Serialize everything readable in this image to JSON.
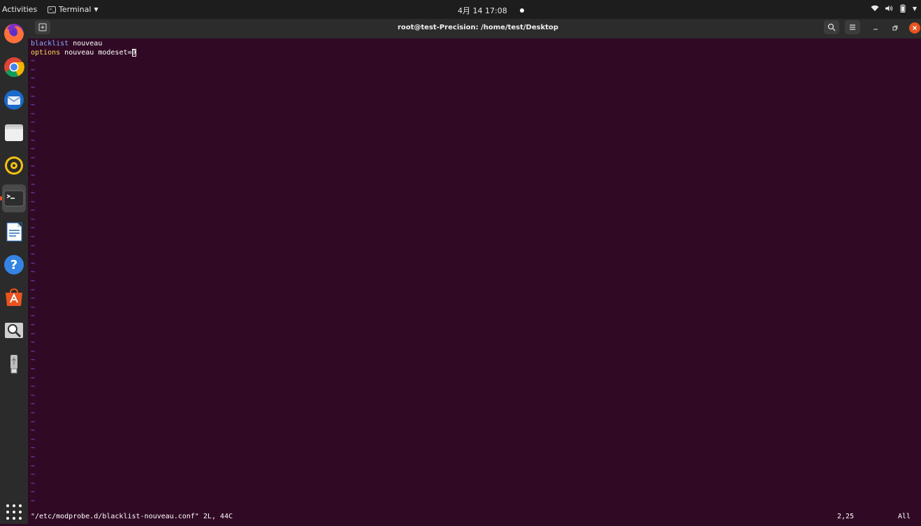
{
  "topbar": {
    "activities": "Activities",
    "app_name": "Terminal",
    "clock": "4月 14  17:08"
  },
  "dock": {
    "items": [
      {
        "name": "firefox-icon"
      },
      {
        "name": "chrome-icon"
      },
      {
        "name": "thunderbird-icon"
      },
      {
        "name": "files-icon"
      },
      {
        "name": "rhythmbox-icon"
      },
      {
        "name": "terminal-icon",
        "active": true
      },
      {
        "name": "writer-icon"
      },
      {
        "name": "help-icon"
      },
      {
        "name": "software-icon"
      },
      {
        "name": "image-viewer-icon"
      },
      {
        "name": "usb-drive-icon"
      },
      {
        "name": "show-apps-icon"
      }
    ]
  },
  "window": {
    "title": "root@test-Precision: /home/test/Desktop"
  },
  "editor": {
    "line1_keyword": "blacklist",
    "line1_rest": " nouveau",
    "line2_keyword": "options",
    "line2_rest": " nouveau modeset=",
    "line2_cursor_char": "0",
    "empty_line_marker": "~",
    "empty_line_count": 51
  },
  "status": {
    "message": "\"/etc/modprobe.d/blacklist-nouveau.conf\" 2L, 44C",
    "position": "2,25",
    "percent": "All"
  },
  "colors": {
    "terminal_bg": "#300a24",
    "accent": "#e95420"
  }
}
